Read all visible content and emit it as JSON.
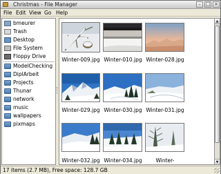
{
  "window": {
    "title": "Christmas - File Manager"
  },
  "menubar": {
    "items": [
      "File",
      "Edit",
      "View",
      "Go",
      "Help"
    ]
  },
  "sidebar": {
    "places": [
      {
        "label": "bmeurer",
        "icon": "home-icon"
      },
      {
        "label": "Trash",
        "icon": "trash-icon"
      },
      {
        "label": "Desktop",
        "icon": "desktop-icon"
      },
      {
        "label": "File System",
        "icon": "filesystem-icon"
      },
      {
        "label": "Floppy Drive",
        "icon": "floppy-icon"
      }
    ],
    "bookmarks": [
      {
        "label": "ModelChecking",
        "icon": "folder-icon"
      },
      {
        "label": "DiplArbeit",
        "icon": "folder-icon"
      },
      {
        "label": "Projects",
        "icon": "folder-icon"
      },
      {
        "label": "Thunar",
        "icon": "folder-icon"
      },
      {
        "label": "network",
        "icon": "folder-icon"
      },
      {
        "label": "music",
        "icon": "folder-icon"
      },
      {
        "label": "wallpapers",
        "icon": "folder-icon"
      },
      {
        "label": "pixmaps",
        "icon": "folder-icon"
      }
    ]
  },
  "files": [
    {
      "name": "Winter-009.jpg",
      "thumb": "photo-thumbnail"
    },
    {
      "name": "Winter-010.jpg",
      "thumb": "photo-thumbnail"
    },
    {
      "name": "Winter-028.jpg",
      "thumb": "photo-thumbnail"
    },
    {
      "name": "Winter-029.jpg",
      "thumb": "photo-thumbnail"
    },
    {
      "name": "Winter-030.jpg",
      "thumb": "photo-thumbnail"
    },
    {
      "name": "Winter-031.jpg",
      "thumb": "photo-thumbnail"
    },
    {
      "name": "Winter-032.jpg",
      "thumb": "photo-thumbnail"
    },
    {
      "name": "Winter-034.jpg",
      "thumb": "photo-thumbnail"
    },
    {
      "name": "Winter-",
      "thumb": "photo-thumbnail"
    }
  ],
  "statusbar": {
    "text": "17 items (2.7 MB), Free space: 128.7 GB"
  },
  "colors": {
    "window_bg": "#ece9d8",
    "folder_blue": "#5b8ac0",
    "selection": "#3b6ea5"
  }
}
